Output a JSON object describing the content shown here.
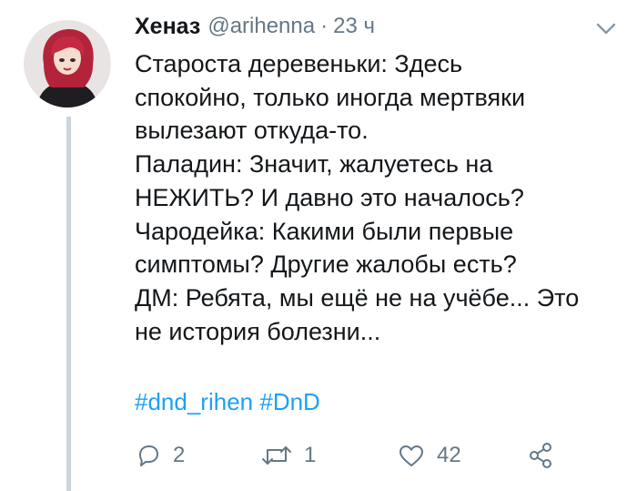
{
  "tweet": {
    "author_name": "Хеназ",
    "author_handle": "@arihenna",
    "separator": "·",
    "time_ago": "23 ч",
    "body_lines": [
      "Староста деревеньки: Здесь",
      "спокойно, только иногда мертвяки",
      "вылезают откуда-то.",
      "Паладин: Значит, жалуетесь на",
      "НЕЖИТЬ? И давно это началось?",
      "Чародейка: Какими были первые",
      "симптомы? Другие жалобы есть?",
      "ДМ: Ребята, мы ещё не на учёбе... Это",
      "не история болезни..."
    ],
    "hashtags": [
      "#dnd_rihen",
      "#DnD"
    ],
    "actions": {
      "reply_count": "2",
      "retweet_count": "1",
      "like_count": "42"
    }
  },
  "icons": {
    "menu": "chevron-down-icon",
    "reply": "reply-icon",
    "retweet": "retweet-icon",
    "like": "heart-icon",
    "share": "share-icon"
  },
  "colors": {
    "link": "#1da1f2",
    "secondary_text": "#657786",
    "thread_line": "#cdd5dc"
  }
}
